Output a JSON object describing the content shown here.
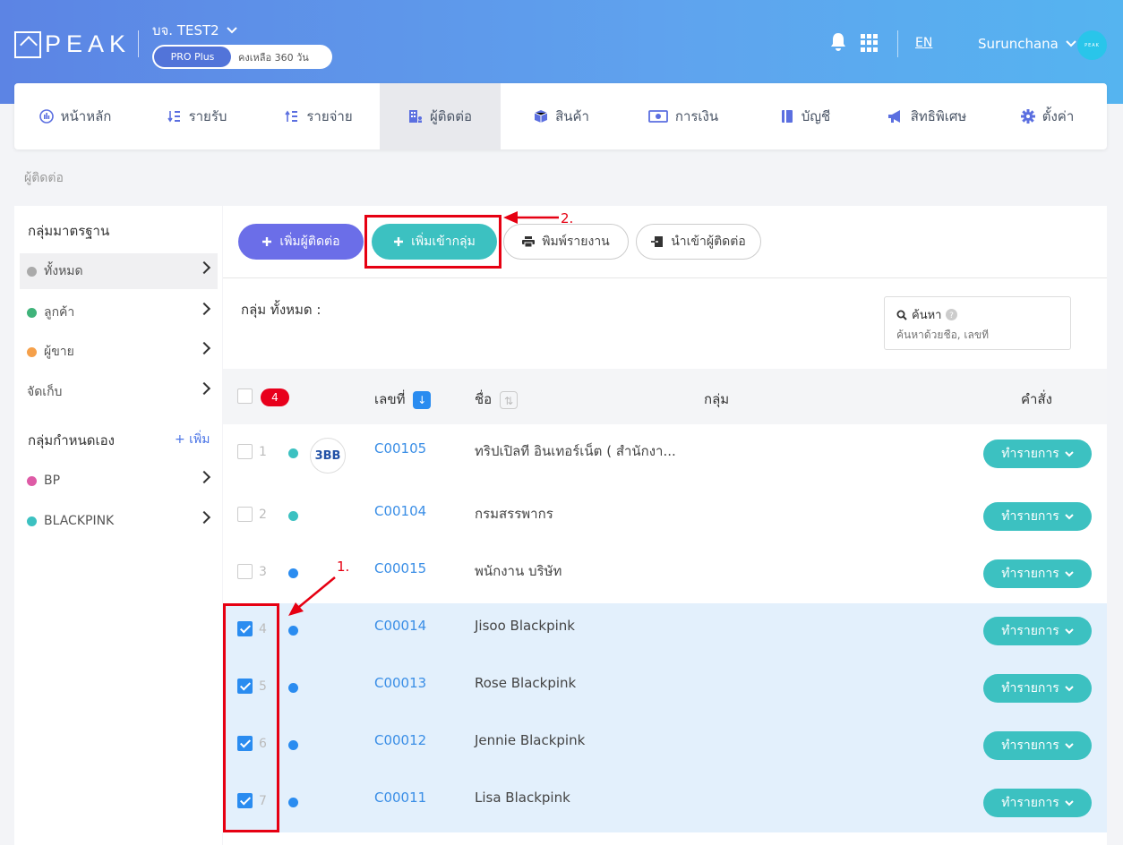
{
  "header": {
    "logo_text": "PEAK",
    "company": "บจ. TEST2",
    "plan_badge": "PRO Plus",
    "plan_remaining": "คงเหลือ 360 วัน",
    "language": "EN",
    "user_name": "Surunchana",
    "avatar_text": "PEAK"
  },
  "nav": {
    "items": [
      {
        "label": "หน้าหลัก",
        "icon": "dashboard-icon"
      },
      {
        "label": "รายรับ",
        "icon": "income-icon"
      },
      {
        "label": "รายจ่าย",
        "icon": "expense-icon"
      },
      {
        "label": "ผู้ติดต่อ",
        "icon": "contacts-icon",
        "active": true
      },
      {
        "label": "สินค้า",
        "icon": "box-icon"
      },
      {
        "label": "การเงิน",
        "icon": "money-icon"
      },
      {
        "label": "บัญชี",
        "icon": "book-icon"
      },
      {
        "label": "สิทธิพิเศษ",
        "icon": "megaphone-icon"
      },
      {
        "label": "ตั้งค่า",
        "icon": "gear-icon"
      }
    ]
  },
  "breadcrumb": "ผู้ติดต่อ",
  "sidebar": {
    "standard_title": "กลุ่มมาตรฐาน",
    "standard_items": [
      {
        "label": "ทั้งหมด",
        "color": "#aaaaaa"
      },
      {
        "label": "ลูกค้า",
        "color": "#3fb37a"
      },
      {
        "label": "ผู้ขาย",
        "color": "#f5a04a"
      }
    ],
    "archive_label": "จัดเก็บ",
    "custom_title": "กลุ่มกำหนดเอง",
    "add_label": "+ เพิ่ม",
    "custom_items": [
      {
        "label": "BP",
        "color": "#de5ba6"
      },
      {
        "label": "BLACKPINK",
        "color": "#3cc1c1"
      }
    ]
  },
  "toolbar": {
    "add_contact": "เพิ่มผู้ติดต่อ",
    "add_to_group": "เพิ่มเข้ากลุ่ม",
    "print_report": "พิมพ์รายงาน",
    "import_contacts": "นำเข้าผู้ติดต่อ"
  },
  "group_label": "กลุ่ม ทั้งหมด :",
  "search": {
    "label": "ค้นหา",
    "placeholder": "ค้นหาด้วยชื่อ, เลขที่"
  },
  "table": {
    "selected_count": "4",
    "col_number": "เลขที่",
    "col_name": "ชื่อ",
    "col_group": "กลุ่ม",
    "col_action": "คำสั่ง",
    "action_label": "ทำรายการ",
    "rows": [
      {
        "num": "1",
        "code": "C00105",
        "name": "ทริปเปิลที อินเทอร์เน็ต ( สำนักงา...",
        "checked": false,
        "dot": "#3cc1c1",
        "logo": "3BB"
      },
      {
        "num": "2",
        "code": "C00104",
        "name": "กรมสรรพากร",
        "checked": false,
        "dot": "#3cc1c1"
      },
      {
        "num": "3",
        "code": "C00015",
        "name": "พนักงาน บริษัท",
        "checked": false,
        "dot": "#2a8cf0"
      },
      {
        "num": "4",
        "code": "C00014",
        "name": "Jisoo Blackpink",
        "checked": true,
        "dot": "#2a8cf0"
      },
      {
        "num": "5",
        "code": "C00013",
        "name": "Rose Blackpink",
        "checked": true,
        "dot": "#2a8cf0"
      },
      {
        "num": "6",
        "code": "C00012",
        "name": "Jennie Blackpink",
        "checked": true,
        "dot": "#2a8cf0"
      },
      {
        "num": "7",
        "code": "C00011",
        "name": "Lisa Blackpink",
        "checked": true,
        "dot": "#2a8cf0"
      }
    ]
  },
  "annotations": {
    "step1": "1.",
    "step2": "2."
  }
}
